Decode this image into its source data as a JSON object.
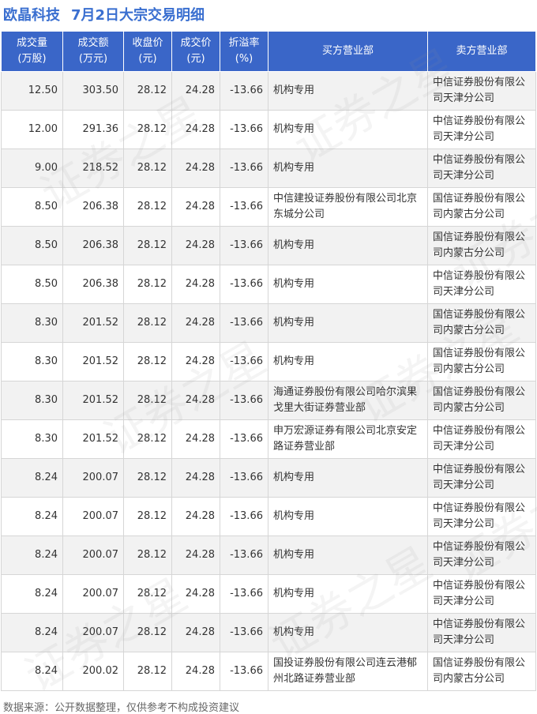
{
  "title": {
    "company": "欧晶科技",
    "subtitle": "7月2日大宗交易明细"
  },
  "table": {
    "headers": [
      [
        "成交量",
        "(万股)"
      ],
      [
        "成交额",
        "(万元)"
      ],
      [
        "收盘价",
        "(元)"
      ],
      [
        "成交价",
        "(元)"
      ],
      [
        "折溢率",
        "(%)"
      ],
      [
        "买方营业部",
        ""
      ],
      [
        "卖方营业部",
        ""
      ]
    ],
    "rows": [
      [
        "12.50",
        "303.50",
        "28.12",
        "24.28",
        "-13.66",
        "机构专用",
        "中信证券股份有限公司天津分公司"
      ],
      [
        "12.00",
        "291.36",
        "28.12",
        "24.28",
        "-13.66",
        "机构专用",
        "中信证券股份有限公司天津分公司"
      ],
      [
        "9.00",
        "218.52",
        "28.12",
        "24.28",
        "-13.66",
        "机构专用",
        "中信证券股份有限公司天津分公司"
      ],
      [
        "8.50",
        "206.38",
        "28.12",
        "24.28",
        "-13.66",
        "中信建投证券股份有限公司北京东城分公司",
        "国信证券股份有限公司内蒙古分公司"
      ],
      [
        "8.50",
        "206.38",
        "28.12",
        "24.28",
        "-13.66",
        "机构专用",
        "国信证券股份有限公司内蒙古分公司"
      ],
      [
        "8.50",
        "206.38",
        "28.12",
        "24.28",
        "-13.66",
        "机构专用",
        "中信证券股份有限公司天津分公司"
      ],
      [
        "8.30",
        "201.52",
        "28.12",
        "24.28",
        "-13.66",
        "机构专用",
        "国信证券股份有限公司内蒙古分公司"
      ],
      [
        "8.30",
        "201.52",
        "28.12",
        "24.28",
        "-13.66",
        "机构专用",
        "国信证券股份有限公司内蒙古分公司"
      ],
      [
        "8.30",
        "201.52",
        "28.12",
        "24.28",
        "-13.66",
        "海通证券股份有限公司哈尔滨果戈里大街证券营业部",
        "国信证券股份有限公司内蒙古分公司"
      ],
      [
        "8.30",
        "201.52",
        "28.12",
        "24.28",
        "-13.66",
        "申万宏源证券有限公司北京安定路证券营业部",
        "中信证券股份有限公司天津分公司"
      ],
      [
        "8.24",
        "200.07",
        "28.12",
        "24.28",
        "-13.66",
        "机构专用",
        "中信证券股份有限公司天津分公司"
      ],
      [
        "8.24",
        "200.07",
        "28.12",
        "24.28",
        "-13.66",
        "机构专用",
        "中信证券股份有限公司天津分公司"
      ],
      [
        "8.24",
        "200.07",
        "28.12",
        "24.28",
        "-13.66",
        "机构专用",
        "中信证券股份有限公司天津分公司"
      ],
      [
        "8.24",
        "200.07",
        "28.12",
        "24.28",
        "-13.66",
        "机构专用",
        "中信证券股份有限公司天津分公司"
      ],
      [
        "8.24",
        "200.07",
        "28.12",
        "24.28",
        "-13.66",
        "机构专用",
        "中信证券股份有限公司天津分公司"
      ],
      [
        "8.24",
        "200.02",
        "28.12",
        "24.28",
        "-13.66",
        "国投证券股份有限公司连云港郁州北路证券营业部",
        "国信证券股份有限公司内蒙古分公司"
      ]
    ]
  },
  "footer": "数据来源：公开数据整理，仅供参考不构成投资建议",
  "watermark": "证券之星",
  "colors": {
    "header_bg": "#3a66c8",
    "title": "#3a6fd0",
    "negative": "#2ea043",
    "stripe": "#f2f2f2"
  }
}
